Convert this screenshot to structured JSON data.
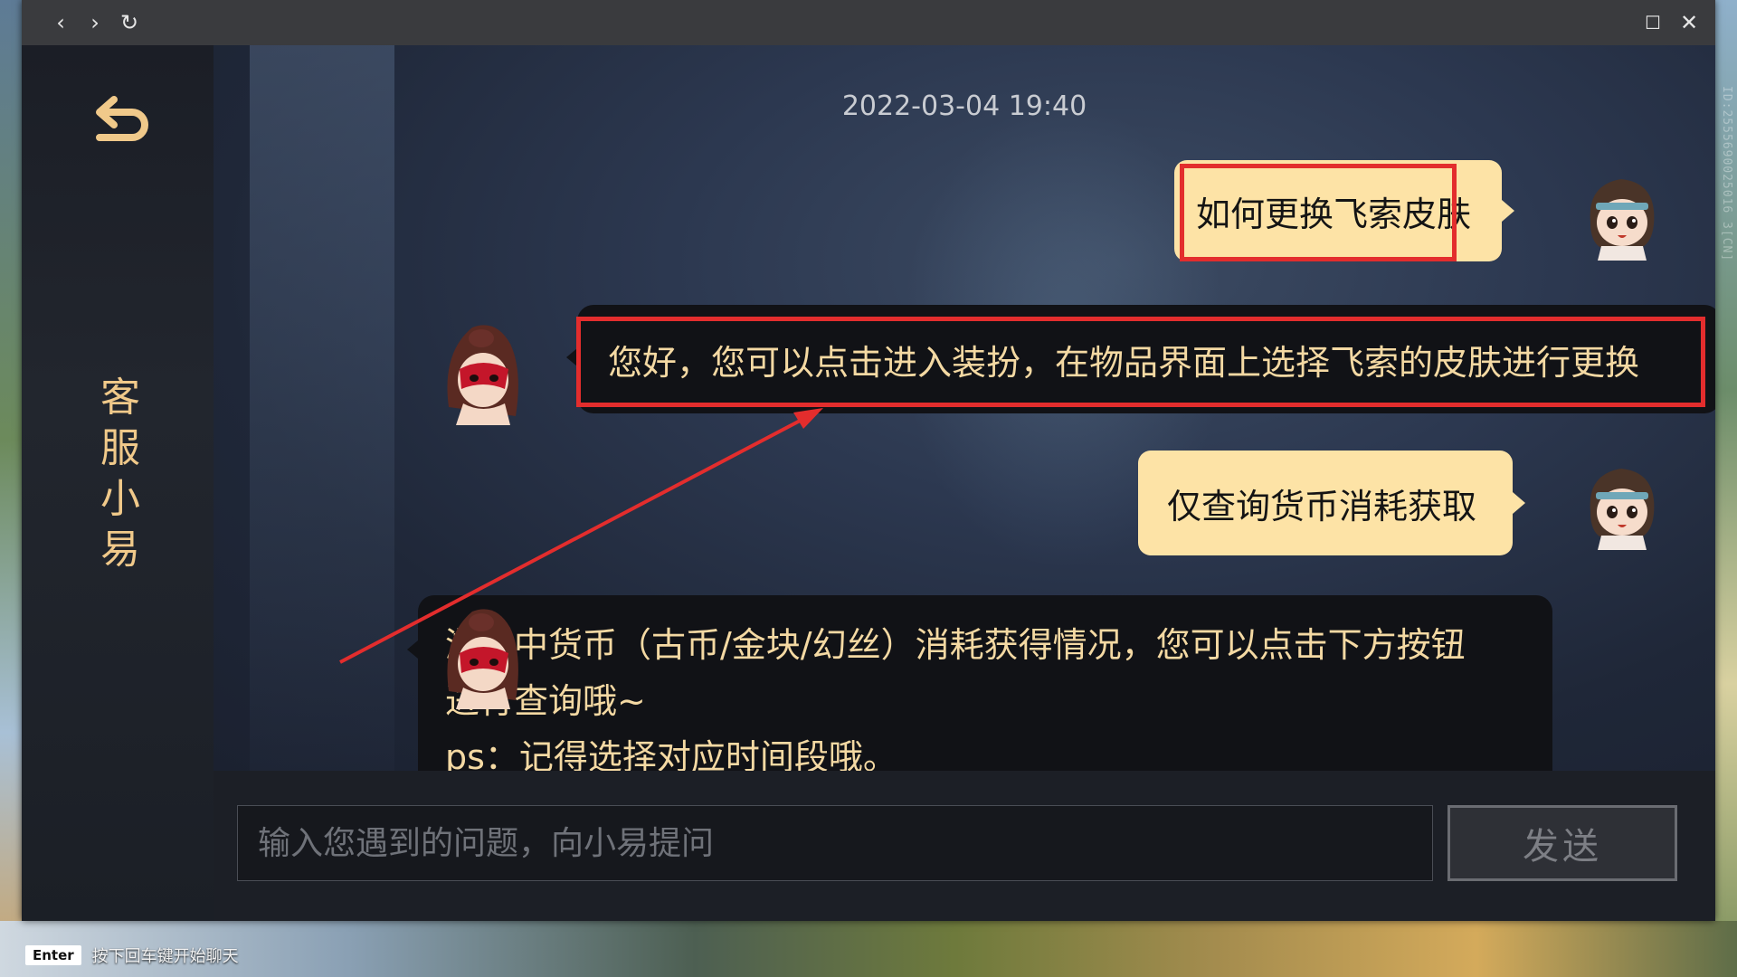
{
  "titlebar": {
    "back_glyph": "‹",
    "forward_glyph": "›",
    "refresh_glyph": "↻",
    "maximize_glyph": "☐",
    "close_glyph": "✕"
  },
  "sidebar": {
    "back_icon": "undo-arrow-icon",
    "title": "客服小易",
    "title_color": "#f0c98a"
  },
  "chat": {
    "timestamp": "2022-03-04 19:40",
    "messages": [
      {
        "from": "user",
        "text": "如何更换飞索皮肤",
        "highlighted": true
      },
      {
        "from": "bot",
        "text": "您好，您可以点击进入装扮，在物品界面上选择飞索的皮肤进行更换",
        "highlighted": true
      },
      {
        "from": "user",
        "text": "仅查询货币消耗获取",
        "highlighted": false
      },
      {
        "from": "bot",
        "line1": "游戏中货币（古币/金块/幻丝）消耗获得情况，您可以点击下方按钮",
        "line2": "进行查询哦~",
        "line3": "ps：记得选择对应时间段哦。",
        "highlighted": false
      }
    ],
    "user_bubble_color": "#fde3a6",
    "bot_text_color": "#f4d9a3",
    "highlight_color": "#e32d2d"
  },
  "input": {
    "placeholder": "输入您遇到的问题，向小易提问",
    "value": "",
    "send_label": "发送"
  },
  "overlay": {
    "id_watermark": "ID:2555690025016 3[CN]",
    "hint_key": "Enter",
    "hint_text": "按下回车键开始聊天"
  }
}
